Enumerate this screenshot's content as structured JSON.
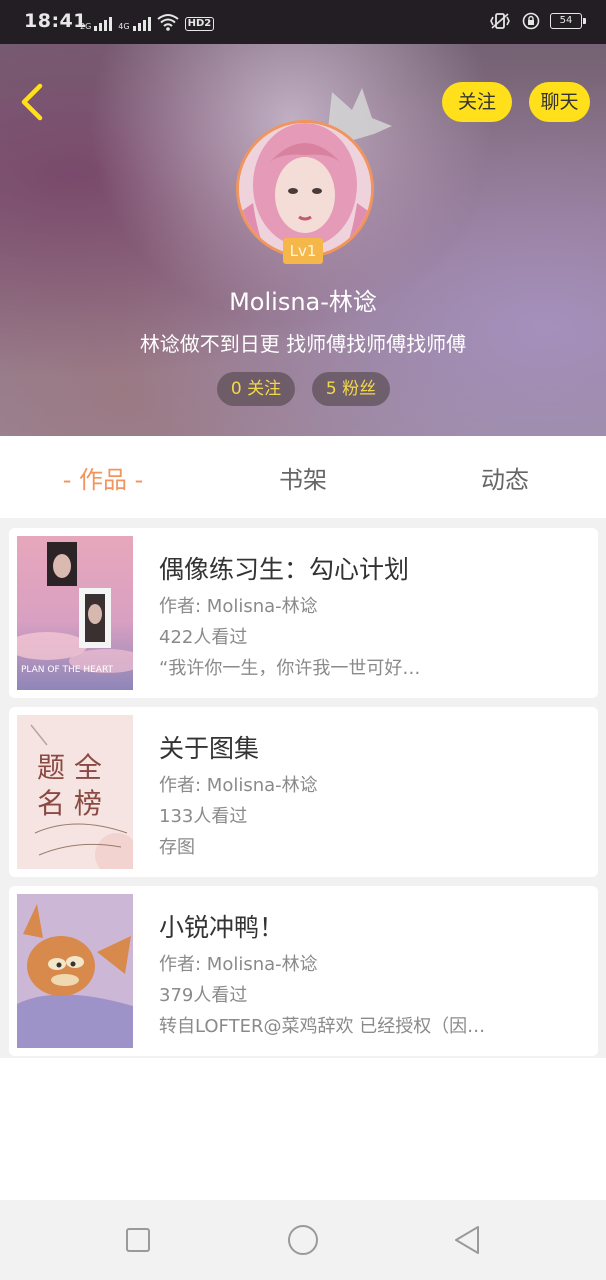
{
  "status_bar": {
    "time": "18:41",
    "network_1": "2G",
    "network_2": "4G",
    "hd_label": "HD2",
    "battery": "54"
  },
  "header": {
    "follow_button": "关注",
    "chat_button": "聊天"
  },
  "profile": {
    "level": "Lv1",
    "name": "Molisna-林谂",
    "bio": "林谂做不到日更 找师傅找师傅找师傅",
    "following": "0 关注",
    "fans": "5 粉丝"
  },
  "tabs": [
    {
      "label": "- 作品 -",
      "active": true
    },
    {
      "label": "书架",
      "active": false
    },
    {
      "label": "动态",
      "active": false
    }
  ],
  "works": [
    {
      "title": "偶像练习生：勾心计划",
      "author": "作者: Molisna-林谂",
      "views": "422人看过",
      "desc": "“我许你一生，你许我一世可好…",
      "cover_text": "PLAN OF THE HEART"
    },
    {
      "title": "关于图集",
      "author": "作者: Molisna-林谂",
      "views": "133人看过",
      "desc": "存图",
      "cover_text_1": "题 全",
      "cover_text_2": "名 榜"
    },
    {
      "title": "小锐冲鸭！",
      "author": "作者: Molisna-林谂",
      "views": "379人看过",
      "desc": "转自LOFTER@菜鸡辞欢 已经授权（因…"
    }
  ],
  "colors": {
    "accent_orange": "#f0955e",
    "button_yellow": "#ffe01a",
    "stat_text_yellow": "#f2d94a"
  }
}
